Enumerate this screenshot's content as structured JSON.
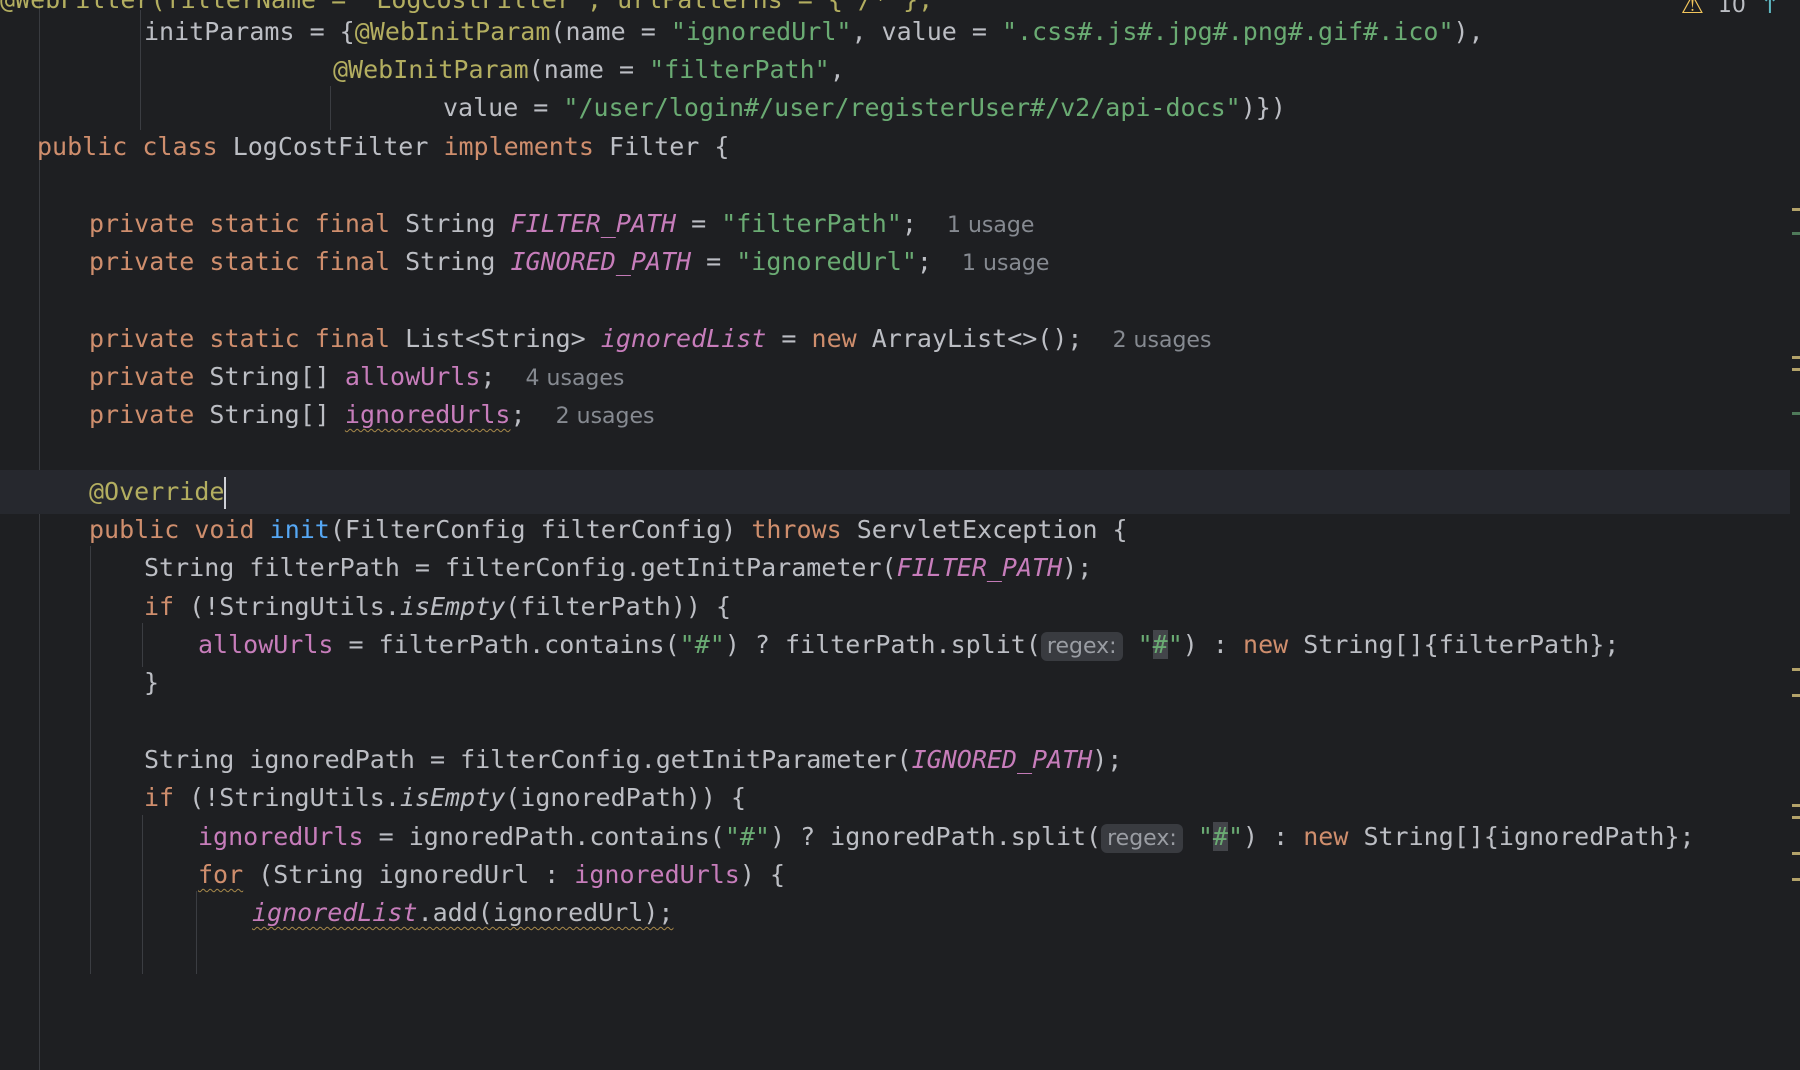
{
  "editor": {
    "lines": {
      "l0": {
        "text": "@WebFilter(filterName = \"LogCostFilter\", urlPatterns = {\"/*\"},"
      },
      "l1": {
        "a": "initParams = {",
        "b": "@WebInitParam",
        "c": "(name = ",
        "d": "\"ignoredUrl\"",
        "e": ", value = ",
        "f": "\".css#.js#.jpg#.png#.gif#.ico\"",
        "g": "),"
      },
      "l2": {
        "a": "@WebInitParam",
        "b": "(name = ",
        "c": "\"filterPath\"",
        "d": ","
      },
      "l3": {
        "a": "value = ",
        "b": "\"/user/login#/user/registerUser#/v2/api-docs\"",
        "c": ")})"
      },
      "l4": {
        "a": "public",
        "b": "class",
        "c": "LogCostFilter",
        "d": "implements",
        "e": "Filter {"
      },
      "l6": {
        "a": "private static final",
        "b": "String",
        "c": "FILTER_PATH",
        "d": " = ",
        "e": "\"filterPath\"",
        "f": ";",
        "hint": "1 usage"
      },
      "l7": {
        "a": "private static final",
        "b": "String",
        "c": "IGNORED_PATH",
        "d": " = ",
        "e": "\"ignoredUrl\"",
        "f": ";",
        "hint": "1 usage"
      },
      "l9": {
        "a": "private static final",
        "b": "List<String>",
        "c": "ignoredList",
        "d": " = ",
        "e": "new",
        "f": "ArrayList<>();",
        "hint": "2 usages"
      },
      "l10": {
        "a": "private",
        "b": "String[]",
        "c": "allowUrls",
        "d": ";",
        "hint": "4 usages"
      },
      "l11": {
        "a": "private",
        "b": "String[]",
        "c": "ignoredUrls",
        "d": ";",
        "hint": "2 usages"
      },
      "l13": {
        "a": "@Override"
      },
      "l14": {
        "a": "public void",
        "b": "init",
        "c": "(FilterConfig filterConfig)",
        "d": "throws",
        "e": "ServletException {"
      },
      "l15": {
        "a": "String filterPath = filterConfig.getInitParameter(",
        "b": "FILTER_PATH",
        "c": ");"
      },
      "l16": {
        "a": "if",
        "b": " (!StringUtils.",
        "c": "isEmpty",
        "d": "(filterPath)) {"
      },
      "l17": {
        "a": "allowUrls",
        "b": " = filterPath.contains(",
        "c": "\"#\"",
        "d": ") ? filterPath.split(",
        "hint": "regex:",
        "e": "\"",
        "f": "#",
        "g": "\"",
        "h": ") : ",
        "i": "new",
        "j": "String[]{filterPath};"
      },
      "l18": {
        "a": "}"
      },
      "l20": {
        "a": "String ignoredPath = filterConfig.getInitParameter(",
        "b": "IGNORED_PATH",
        "c": ");"
      },
      "l21": {
        "a": "if",
        "b": " (!StringUtils.",
        "c": "isEmpty",
        "d": "(ignoredPath)) {"
      },
      "l22": {
        "a": "ignoredUrls",
        "b": " = ignoredPath.contains(",
        "c": "\"#\"",
        "d": ") ? ignoredPath.split(",
        "hint": "regex:",
        "e": "\"",
        "f": "#",
        "g": "\"",
        "h": ") : ",
        "i": "new",
        "j": "String[]{ignoredPath};"
      },
      "l23": {
        "a": "for",
        "b": " (String ignoredUrl : ",
        "c": "ignoredUrls",
        "d": ") {"
      },
      "l24": {
        "a": "ignoredList",
        "b": ".add(ignoredUrl);"
      }
    }
  },
  "status": {
    "warning_count": "10",
    "warning_icon": "warning-triangle-icon",
    "arrow_icon": "arrow-up-icon"
  },
  "colors": {
    "background": "#1e1f22",
    "keyword": "#cf8e6d",
    "string": "#6aab73",
    "annotation": "#b3ae60",
    "field": "#c77dbb",
    "function": "#56a8f5"
  }
}
